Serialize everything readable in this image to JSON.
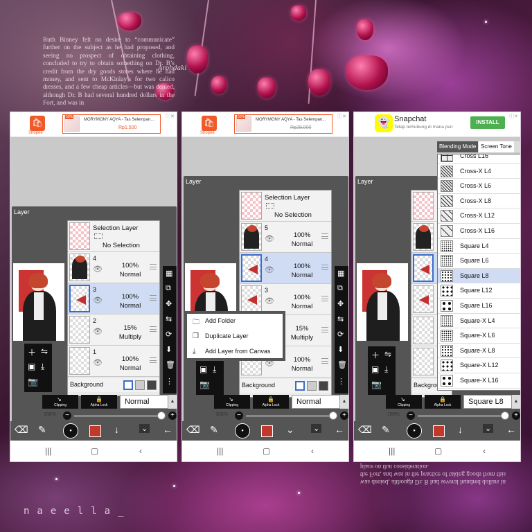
{
  "background": {
    "paper_text_top": "Ruth Binney felt no desire to “communicate” further on the subject as he had proposed, and seeing no prospect of obtaining clothing, concluded to try to obtain something on Dr. B’s credit from the dry goods stores where he had money, and sent to McKinlay’s for two calico dresses, and a few cheap articles—but was denied, although Dr. B had several hundred dollars in the Fort, and was in",
    "paper_text_bottom": "was denied, although Dr. B had several hundred dollars in the Fort, and was in the practice of taking goods from this place on that consideration.",
    "watermark": "naeella_",
    "signature": "Arohdaki"
  },
  "ads": {
    "shopee_brand": "Shopee",
    "shopee_product": "MORYMONY AQYA - Tas Selempan...",
    "shopee_price_1": "Rp1.500",
    "shopee_price_2": "Rp29.000",
    "shopee_sale": "50%",
    "snapchat_title": "Snapchat",
    "snapchat_subtitle": "Tetap terhubung di mana pun",
    "snapchat_install": "INSTALL"
  },
  "panel": {
    "title": "Layer",
    "selection_layer_title": "Selection Layer",
    "selection_status": "No Selection",
    "background_label": "Background",
    "clipping_label": "Clipping",
    "alpha_lock_label": "Alpha Lock",
    "opacity_value": "100%"
  },
  "screen1": {
    "layers": [
      {
        "num": "4",
        "opacity": "100%",
        "blend": "Normal"
      },
      {
        "num": "3",
        "opacity": "100%",
        "blend": "Normal"
      },
      {
        "num": "2",
        "opacity": "15%",
        "blend": "Multiply"
      },
      {
        "num": "1",
        "opacity": "100%",
        "blend": "Normal"
      }
    ],
    "blend_mode": "Normal"
  },
  "screen2": {
    "layers": [
      {
        "num": "5",
        "opacity": "100%",
        "blend": "Normal"
      },
      {
        "num": "4",
        "opacity": "100%",
        "blend": "Normal"
      },
      {
        "num": "3",
        "opacity": "100%",
        "blend": "Normal"
      },
      {
        "num": "2",
        "opacity": "15%",
        "blend": "Multiply"
      },
      {
        "num": "1",
        "opacity": "100%",
        "blend": "Normal"
      }
    ],
    "blend_mode": "Normal",
    "menu": [
      "Add Folder",
      "Duplicate Layer",
      "Add Layer from Canvas"
    ]
  },
  "screen3": {
    "blend_mode": "Square L8",
    "tabs": [
      "Blending Mode",
      "Screen Tone"
    ],
    "tones": [
      "Cross L16",
      "Cross-X L4",
      "Cross-X L6",
      "Cross-X L8",
      "Cross-X L12",
      "Cross-X L16",
      "Square L4",
      "Square L6",
      "Square L8",
      "Square L12",
      "Square L16",
      "Square-X L4",
      "Square-X L6",
      "Square-X L8",
      "Square-X L12",
      "Square-X L16"
    ],
    "selected_tone_index": 8
  },
  "colors": {
    "accent_selected": "#cfdcf4",
    "brush_color": "#c0392b",
    "install_green": "#4caf50",
    "shopee_orange": "#f05a28"
  },
  "icons": [
    "add-layer-icon",
    "transform-icon",
    "camera-icon",
    "checker-icon",
    "move-icon",
    "flip-icon",
    "merge-down-icon",
    "trash-icon",
    "more-icon",
    "brush-icon",
    "eraser-icon",
    "arrow-down-icon",
    "back-icon",
    "eye-icon"
  ]
}
